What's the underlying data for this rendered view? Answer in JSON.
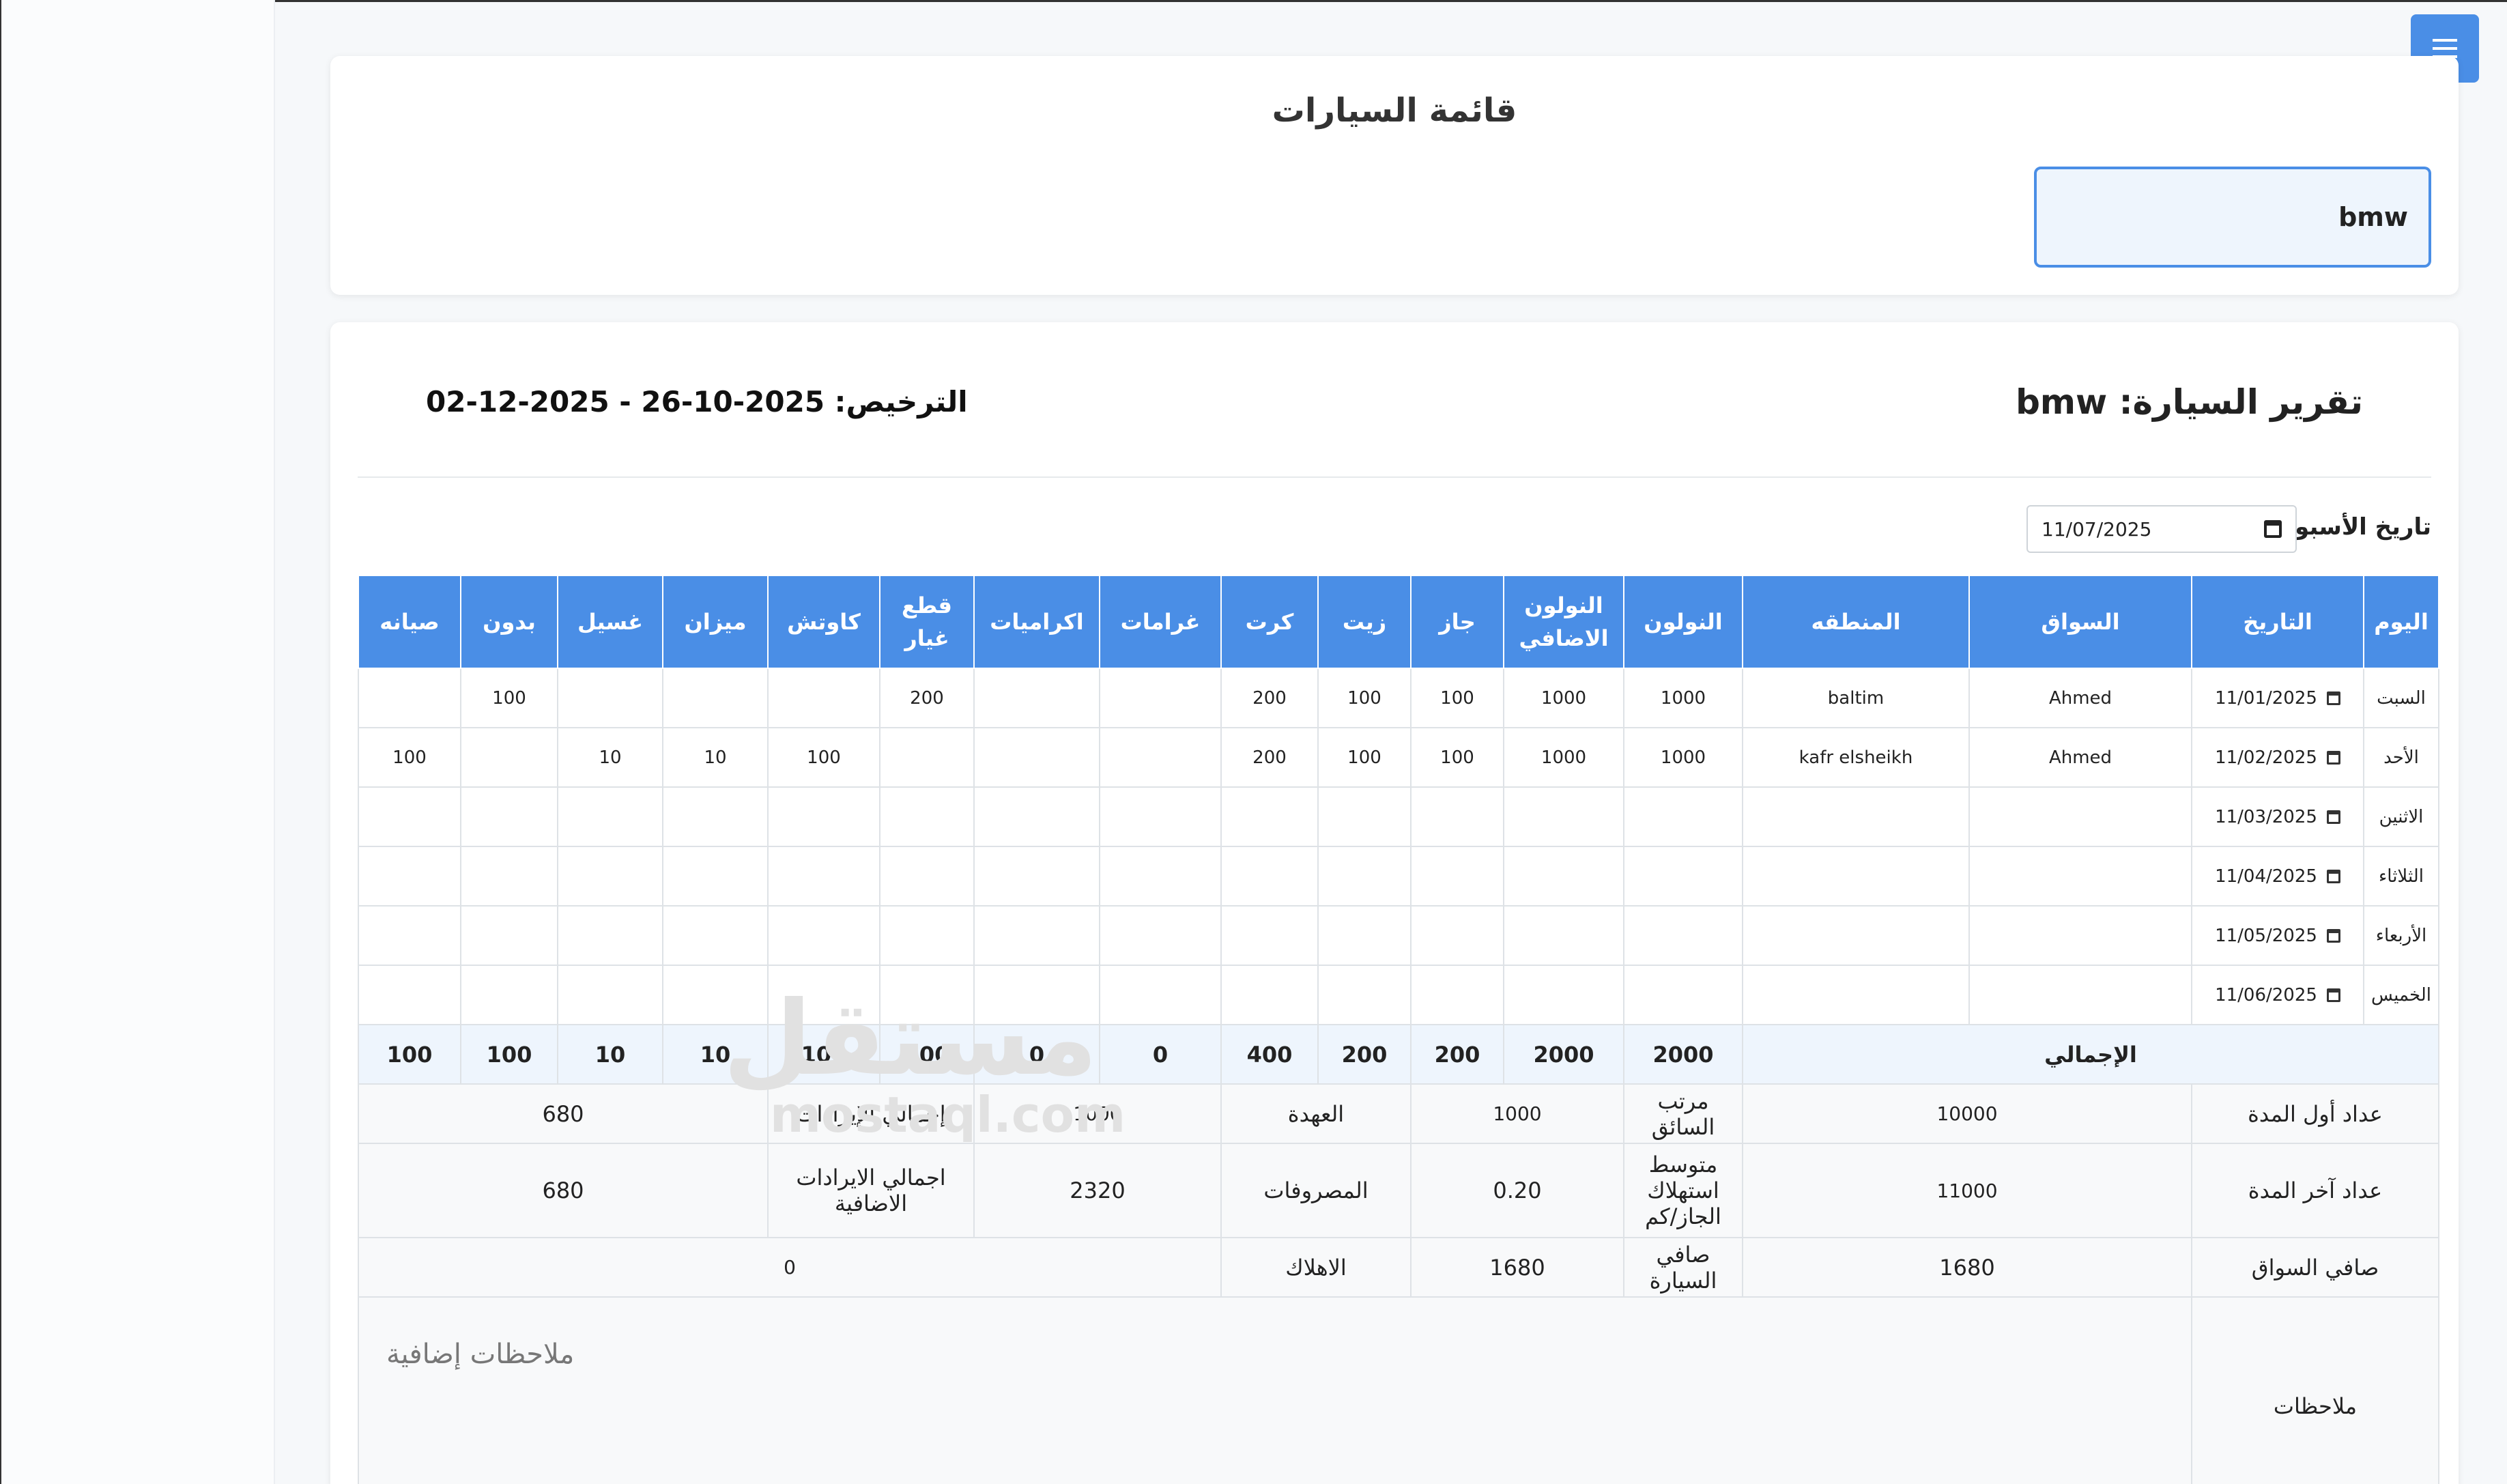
{
  "header": {
    "title": "قائمة السيارات",
    "selected_car": "bmw"
  },
  "report": {
    "title": "تقرير السيارة: bmw",
    "license": "الترخيص: 2025-10-26 - 2025-12-02",
    "week_label": "تاريخ الأسبوع:",
    "week_date": "11/07/2025"
  },
  "table": {
    "headers": [
      "اليوم",
      "التاريخ",
      "السواق",
      "المنطقه",
      "النولون",
      "النولون الاضافي",
      "جاز",
      "زيت",
      "كرت",
      "غرامات",
      "اكراميات",
      "قطع غيار",
      "كاوتش",
      "ميزان",
      "غسيل",
      "بدون",
      "صيانه"
    ],
    "rows": [
      {
        "day": "السبت",
        "date": "11/01/2025",
        "cells": [
          "Ahmed",
          "baltim",
          "1000",
          "1000",
          "100",
          "100",
          "200",
          "",
          "",
          "200",
          "",
          "",
          "",
          "100",
          ""
        ]
      },
      {
        "day": "الأحد",
        "date": "11/02/2025",
        "cells": [
          "Ahmed",
          "kafr elsheikh",
          "1000",
          "1000",
          "100",
          "100",
          "200",
          "",
          "",
          "",
          "100",
          "10",
          "10",
          "",
          "100"
        ]
      },
      {
        "day": "الاثنين",
        "date": "11/03/2025",
        "cells": [
          "",
          "",
          "",
          "",
          "",
          "",
          "",
          "",
          "",
          "",
          "",
          "",
          "",
          "",
          ""
        ]
      },
      {
        "day": "الثلاثاء",
        "date": "11/04/2025",
        "cells": [
          "",
          "",
          "",
          "",
          "",
          "",
          "",
          "",
          "",
          "",
          "",
          "",
          "",
          "",
          ""
        ]
      },
      {
        "day": "الأربعاء",
        "date": "11/05/2025",
        "cells": [
          "",
          "",
          "",
          "",
          "",
          "",
          "",
          "",
          "",
          "",
          "",
          "",
          "",
          "",
          ""
        ]
      },
      {
        "day": "الخميس",
        "date": "11/06/2025",
        "cells": [
          "",
          "",
          "",
          "",
          "",
          "",
          "",
          "",
          "",
          "",
          "",
          "",
          "",
          "",
          ""
        ]
      }
    ],
    "totals": {
      "label": "الإجمالي",
      "values": [
        "2000",
        "2000",
        "200",
        "200",
        "400",
        "0",
        "0",
        "200",
        "100",
        "10",
        "10",
        "100",
        "100"
      ]
    },
    "summary": {
      "start_counter_label": "عداد أول المدة",
      "start_counter": "10000",
      "driver_salary_label": "مرتب السائق",
      "driver_salary": "1000",
      "custody_label": "العهدة",
      "custody": "1000",
      "total_revenue_label": "إجمالي الإيرادات",
      "total_revenue": "680",
      "end_counter_label": "عداد آخر المدة",
      "end_counter": "11000",
      "avg_fuel_label": "متوسط استهلاك الجاز/كم",
      "avg_fuel": "0.20",
      "expenses_label": "المصروفات",
      "expenses": "2320",
      "extra_revenue_label": "اجمالي الايرادات الاضافية",
      "extra_revenue": "680",
      "driver_net_label": "صافي السواق",
      "driver_net": "1680",
      "car_net_label": "صافي السيارة",
      "car_net": "1680",
      "depreciation_label": "الاهلاك",
      "depreciation": "0",
      "notes_label": "ملاحظات",
      "notes_placeholder": "ملاحظات إضافية"
    }
  },
  "watermark": {
    "arabic": "مستقل",
    "latin": "mostaql.com"
  },
  "colors": {
    "accent": "#4a8ee6",
    "totals_bg": "#eef5fd",
    "summary_bg": "#f8f9fa"
  },
  "icons": {
    "menu": "hamburger-icon",
    "calendar": "calendar-icon"
  }
}
